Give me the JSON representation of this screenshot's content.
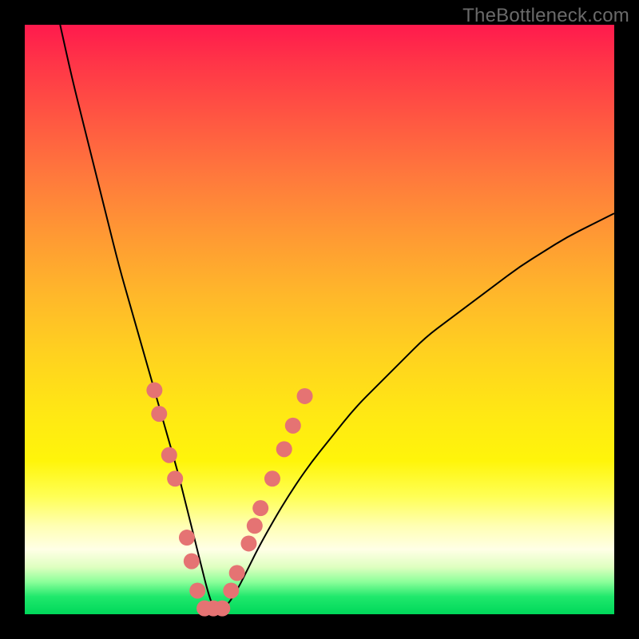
{
  "watermark": "TheBottleneck.com",
  "chart_data": {
    "type": "line",
    "title": "",
    "xlabel": "",
    "ylabel": "",
    "xlim": [
      0,
      100
    ],
    "ylim": [
      0,
      100
    ],
    "grid": false,
    "legend": false,
    "series": [
      {
        "name": "curve",
        "color": "#000000",
        "stroke_width": 2,
        "x": [
          6,
          8,
          10,
          12,
          14,
          16,
          18,
          20,
          22,
          24,
          26,
          27,
          28,
          29,
          30,
          31,
          32,
          34,
          36,
          38,
          40,
          44,
          48,
          52,
          56,
          60,
          64,
          68,
          72,
          76,
          80,
          84,
          88,
          92,
          96,
          100
        ],
        "y": [
          100,
          91,
          83,
          75,
          67,
          59,
          52,
          45,
          38,
          31,
          24,
          20,
          16,
          12,
          8,
          4,
          1,
          1,
          4,
          8,
          12,
          19,
          25,
          30,
          35,
          39,
          43,
          47,
          50,
          53,
          56,
          59,
          61.5,
          64,
          66,
          68
        ]
      }
    ],
    "markers": {
      "name": "highlight-dots",
      "color": "#e57373",
      "radius": 10,
      "points": [
        {
          "x": 22.0,
          "y": 38
        },
        {
          "x": 22.8,
          "y": 34
        },
        {
          "x": 24.5,
          "y": 27
        },
        {
          "x": 25.5,
          "y": 23
        },
        {
          "x": 27.5,
          "y": 13
        },
        {
          "x": 28.3,
          "y": 9
        },
        {
          "x": 29.3,
          "y": 4
        },
        {
          "x": 30.5,
          "y": 1
        },
        {
          "x": 32.0,
          "y": 1
        },
        {
          "x": 33.5,
          "y": 1
        },
        {
          "x": 35.0,
          "y": 4
        },
        {
          "x": 36.0,
          "y": 7
        },
        {
          "x": 38.0,
          "y": 12
        },
        {
          "x": 39.0,
          "y": 15
        },
        {
          "x": 40.0,
          "y": 18
        },
        {
          "x": 42.0,
          "y": 23
        },
        {
          "x": 44.0,
          "y": 28
        },
        {
          "x": 45.5,
          "y": 32
        },
        {
          "x": 47.5,
          "y": 37
        }
      ]
    },
    "background_gradient": {
      "direction": "vertical",
      "stops": [
        {
          "pos": 0.0,
          "color": "#ff1a4d"
        },
        {
          "pos": 0.5,
          "color": "#ffc820"
        },
        {
          "pos": 0.8,
          "color": "#ffff66"
        },
        {
          "pos": 0.92,
          "color": "#e6ffcc"
        },
        {
          "pos": 1.0,
          "color": "#00d85a"
        }
      ]
    }
  }
}
